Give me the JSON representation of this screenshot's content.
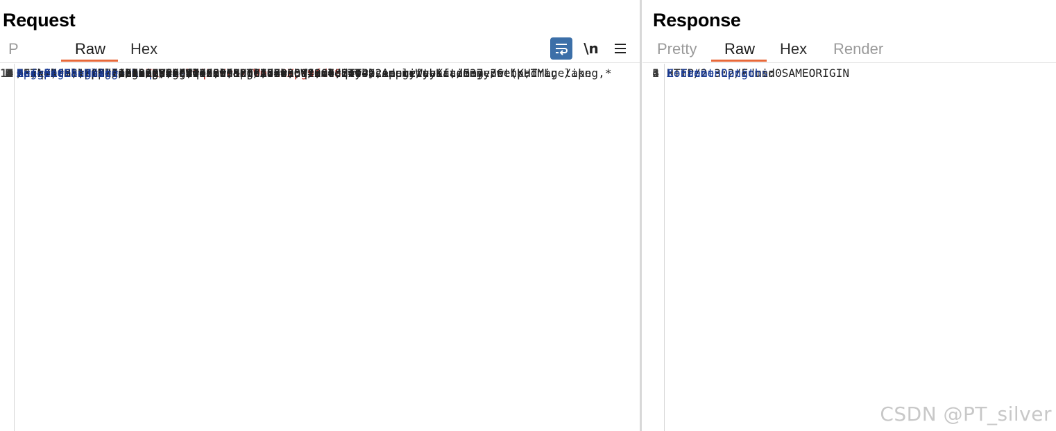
{
  "request": {
    "title": "Request",
    "tabs": [
      {
        "label": "P"
      },
      {
        "label": "Raw"
      },
      {
        "label": "Hex"
      }
    ],
    "active_tab": "Raw",
    "toolbar": {
      "wrap_icon": "wrap-lines-icon",
      "newline_label": "\\n",
      "menu_icon": "hamburger-menu-icon"
    },
    "line_numbers": [
      "1",
      "2",
      "3",
      "4",
      "5",
      "6",
      "7",
      "8",
      "9",
      "10",
      "",
      "11",
      "",
      "",
      "12",
      "13",
      "14",
      "15",
      "16",
      "17",
      "18",
      "19"
    ],
    "lines": [
      {
        "segments": [
          {
            "t": "GET /admin-roles?",
            "c": "hv"
          },
          {
            "t": "username",
            "c": "pn"
          },
          {
            "t": "=",
            "c": "hv"
          },
          {
            "t": "wiener",
            "c": "pv"
          },
          {
            "t": "&",
            "c": "hv"
          },
          {
            "t": "action",
            "c": "pn"
          },
          {
            "t": "=",
            "c": "hv"
          },
          {
            "t": "upgrade",
            "c": "pv"
          },
          {
            "t": " HTTP/2",
            "c": "hv"
          }
        ]
      },
      {
        "segments": [
          {
            "t": "Host",
            "c": "hn"
          },
          {
            "t": ": 0a81009d04ed8503806c763a001200ed.web-security-academy.net",
            "c": "hv"
          }
        ]
      },
      {
        "segments": [
          {
            "t": "Cookie",
            "c": "hn"
          },
          {
            "t": ": ",
            "c": "hv"
          },
          {
            "t": "session",
            "c": "pn"
          },
          {
            "t": "=",
            "c": "hv"
          },
          {
            "t": "oLiZR9rLdhCq59FnB2nWmSEBXu99fm7S",
            "c": "pv"
          }
        ]
      },
      {
        "segments": [
          {
            "t": "Cache-Control",
            "c": "hn"
          },
          {
            "t": ": max-age=0",
            "c": "hv"
          }
        ]
      },
      {
        "segments": [
          {
            "t": "Sec-Ch-Ua",
            "c": "hn"
          },
          {
            "t": ": \"Chromium\";v=\"113\", \"Not-A.Brand\";v=\"24\"",
            "c": "hv"
          }
        ]
      },
      {
        "segments": [
          {
            "t": "Sec-Ch-Ua-Mobile",
            "c": "hn"
          },
          {
            "t": ": ?0",
            "c": "hv"
          }
        ]
      },
      {
        "segments": [
          {
            "t": "Sec-Ch-Ua-Platform",
            "c": "hn"
          },
          {
            "t": ": \"Windows\"",
            "c": "hv"
          }
        ]
      },
      {
        "segments": [
          {
            "t": "Upgrade-Insecure-Requests",
            "c": "hn"
          },
          {
            "t": ": 1",
            "c": "hv"
          }
        ]
      },
      {
        "segments": [
          {
            "t": "Origin",
            "c": "hn"
          },
          {
            "t": ": https://0a81009d04ed8503806c763a001200ed.web-security-academy.net",
            "c": "hv"
          }
        ]
      },
      {
        "segments": [
          {
            "t": "User-Agent",
            "c": "hn"
          },
          {
            "t": ": Mozilla/5.0 (Windows NT 10.0; Win64; x64) AppleWebKit/537.36 (KHTML, like",
            "c": "hv"
          }
        ]
      },
      {
        "segments": [
          {
            "t": "Gecko) Chrome/113.0.5672.127 Safari/537.36",
            "c": "hv"
          }
        ]
      },
      {
        "segments": [
          {
            "t": "Accept",
            "c": "hn"
          },
          {
            "t": ":",
            "c": "hv"
          }
        ]
      },
      {
        "segments": [
          {
            "t": "text/html,application/xhtml+xml,application/xml;q=0.9,image/avif,image/webp,image/apng,*",
            "c": "hv"
          }
        ]
      },
      {
        "segments": [
          {
            "t": "/*;q=0.8,application/signed-exchange;v=b3;q=0.7",
            "c": "hv"
          }
        ]
      },
      {
        "segments": [
          {
            "t": "Sec-Fetch-Site",
            "c": "hn"
          },
          {
            "t": ": same-origin",
            "c": "hv"
          }
        ]
      },
      {
        "segments": [
          {
            "t": "Sec-Fetch-Mode",
            "c": "hn"
          },
          {
            "t": ": navigate",
            "c": "hv"
          }
        ]
      },
      {
        "segments": [
          {
            "t": "Sec-Fetch-User",
            "c": "hn"
          },
          {
            "t": ": ?1",
            "c": "hv"
          }
        ]
      },
      {
        "segments": [
          {
            "t": "Sec-Fetch-Dest",
            "c": "hn"
          },
          {
            "t": ": document",
            "c": "hv"
          }
        ]
      },
      {
        "segments": [
          {
            "t": "Referer",
            "c": "hn"
          },
          {
            "t": ": https://0a81009d04ed8503806c763a001200ed.web-security-academy.net/admin",
            "c": "hv"
          }
        ]
      },
      {
        "segments": [
          {
            "t": "Accept-Encoding",
            "c": "hn"
          },
          {
            "t": ": gzip, deflate",
            "c": "hv"
          }
        ]
      },
      {
        "segments": [
          {
            "t": "Accept-Language",
            "c": "hn"
          },
          {
            "t": ": zh-CN,zh;q=0.9",
            "c": "hv"
          }
        ]
      },
      {
        "segments": []
      }
    ]
  },
  "response": {
    "title": "Response",
    "tabs": [
      {
        "label": "Pretty"
      },
      {
        "label": "Raw"
      },
      {
        "label": "Hex"
      },
      {
        "label": "Render"
      }
    ],
    "active_tab": "Raw",
    "line_numbers": [
      "1",
      "2",
      "3",
      "4",
      "5",
      "6"
    ],
    "lines": [
      {
        "segments": [
          {
            "t": "HTTP/2 302 Found",
            "c": "hv"
          }
        ]
      },
      {
        "segments": [
          {
            "t": "Location",
            "c": "hn"
          },
          {
            "t": ": /admin",
            "c": "hv"
          }
        ]
      },
      {
        "segments": [
          {
            "t": "X-Frame-Options",
            "c": "hn"
          },
          {
            "t": ": SAMEORIGIN",
            "c": "hv"
          }
        ]
      },
      {
        "segments": [
          {
            "t": "Content-Length",
            "c": "hn"
          },
          {
            "t": ": 0",
            "c": "hv"
          }
        ]
      },
      {
        "segments": []
      },
      {
        "segments": []
      }
    ]
  },
  "watermark": "CSDN @PT_silver",
  "colors": {
    "accent": "#e8693a",
    "header_name": "#1a3b94",
    "param_value": "#b8281d",
    "wrap_button": "#3c6fa8"
  }
}
